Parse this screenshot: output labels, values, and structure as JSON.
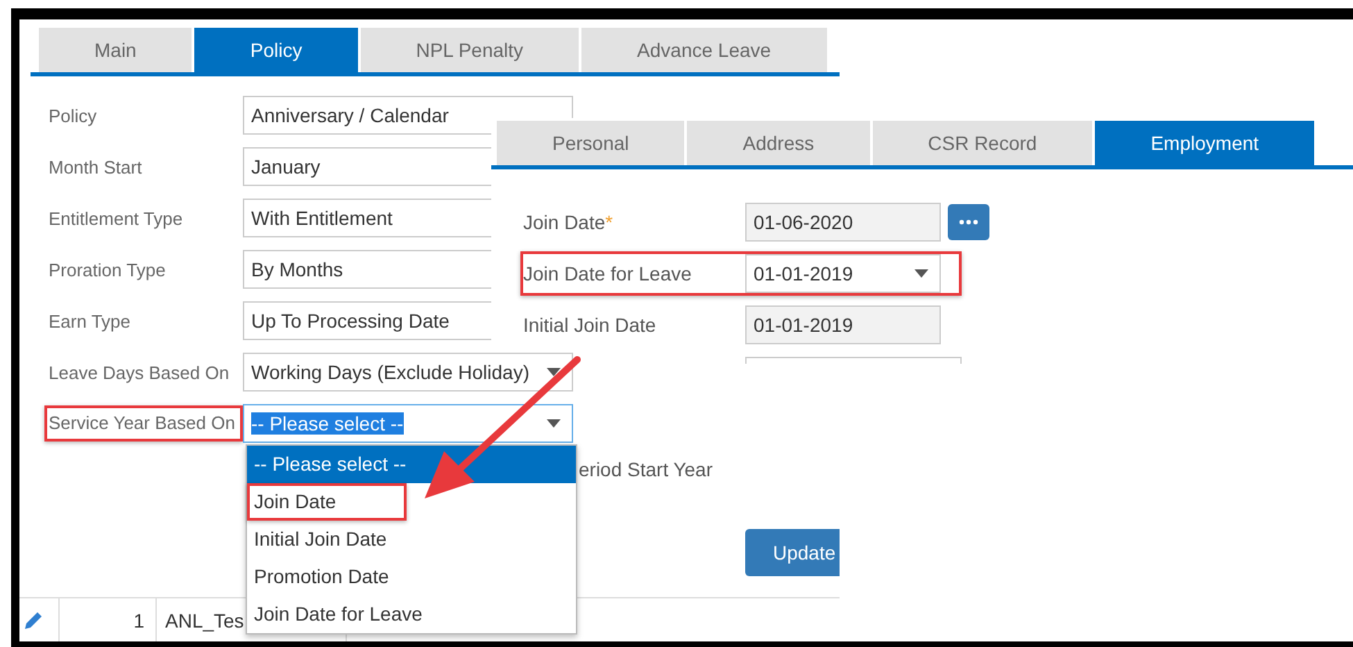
{
  "policy_panel": {
    "tabs": [
      {
        "label": "Main",
        "selected": false
      },
      {
        "label": "Policy",
        "selected": true
      },
      {
        "label": "NPL Penalty",
        "selected": false
      },
      {
        "label": "Advance Leave",
        "selected": false
      }
    ],
    "fields": [
      {
        "label": "Policy",
        "value": "Anniversary / Calendar",
        "kind": "text",
        "focused": false,
        "highlighted": false
      },
      {
        "label": "Month Start",
        "value": "January",
        "kind": "text",
        "focused": false,
        "highlighted": false
      },
      {
        "label": "Entitlement Type",
        "value": "With Entitlement",
        "kind": "text",
        "focused": false,
        "highlighted": false
      },
      {
        "label": "Proration Type",
        "value": "By Months",
        "kind": "text",
        "focused": false,
        "highlighted": false
      },
      {
        "label": "Earn Type",
        "value": "Up To Processing Date",
        "kind": "text",
        "focused": false,
        "highlighted": false
      },
      {
        "label": "Leave Days Based On",
        "value": "Working Days (Exclude Holiday)",
        "kind": "select",
        "focused": false,
        "highlighted": false
      },
      {
        "label": "Service Year Based On",
        "value": "-- Please select --",
        "kind": "select",
        "focused": true,
        "highlighted": true
      }
    ],
    "dropdown": [
      {
        "label": "-- Please select --",
        "selected": true,
        "highlighted": false
      },
      {
        "label": "Join Date",
        "selected": false,
        "highlighted": true
      },
      {
        "label": "Initial Join Date",
        "selected": false,
        "highlighted": false
      },
      {
        "label": "Promotion Date",
        "selected": false,
        "highlighted": false
      },
      {
        "label": "Join Date for Leave",
        "selected": false,
        "highlighted": false
      }
    ],
    "table_row": {
      "number": "1",
      "name": "ANL_Tes"
    }
  },
  "employment_panel": {
    "tabs": [
      {
        "label": "Personal",
        "selected": false
      },
      {
        "label": "Address",
        "selected": false
      },
      {
        "label": "CSR Record",
        "selected": false
      },
      {
        "label": "Employment",
        "selected": true
      }
    ],
    "fields": [
      {
        "label": "Join Date",
        "required_mark": "*",
        "value": "01-06-2020",
        "kind": "readonly",
        "picker_button": true,
        "highlighted": false
      },
      {
        "label": "Join Date for Leave",
        "value": "01-01-2019",
        "kind": "select",
        "picker_button": false,
        "highlighted": true
      },
      {
        "label": "Initial Join Date",
        "value": "01-01-2019",
        "kind": "readonly",
        "picker_button": false,
        "highlighted": false
      },
      {
        "kind": "partial",
        "picker_button": false,
        "highlighted": false
      }
    ],
    "note": "eriod Start Year",
    "update_button": "Update"
  }
}
